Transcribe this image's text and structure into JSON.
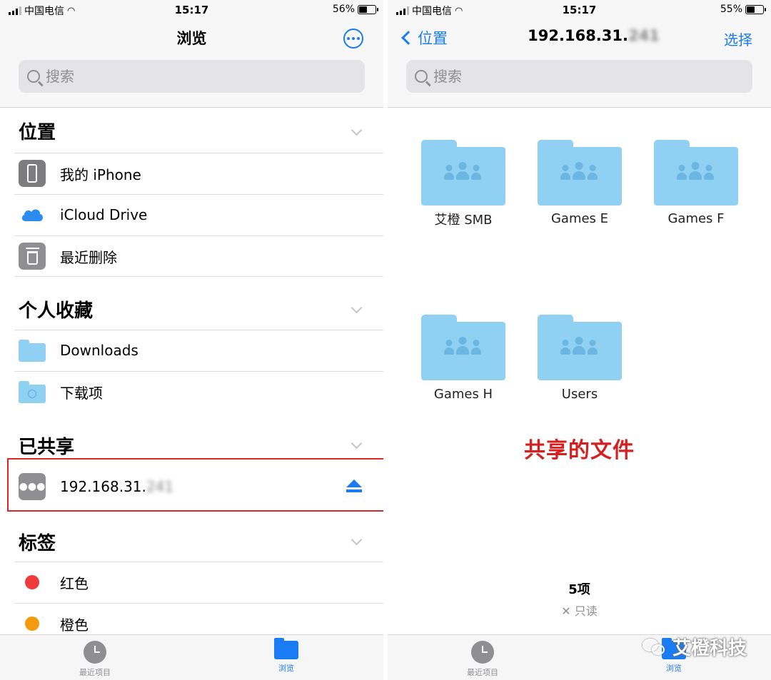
{
  "left": {
    "status": {
      "carrier": "中国电信",
      "time": "15:17",
      "battery": "56%",
      "battery_level": 0.56
    },
    "title": "浏览",
    "search_placeholder": "搜索",
    "sections": {
      "locations": {
        "header": "位置",
        "items": [
          "我的 iPhone",
          "iCloud Drive",
          "最近删除"
        ]
      },
      "favorites": {
        "header": "个人收藏",
        "items": [
          "Downloads",
          "下载项"
        ]
      },
      "shared": {
        "header": "已共享",
        "server_prefix": "192.168.31.",
        "server_suffix_blurred": "241"
      },
      "tags": {
        "header": "标签",
        "items": [
          {
            "label": "红色",
            "color": "#f03b3b"
          },
          {
            "label": "橙色",
            "color": "#f59a0c"
          }
        ]
      }
    },
    "tabs": {
      "recents": "最近项目",
      "browse": "浏览"
    }
  },
  "right": {
    "status": {
      "carrier": "中国电信",
      "time": "15:17",
      "battery": "55%",
      "battery_level": 0.55
    },
    "back_label": "位置",
    "title_prefix": "192.168.31.",
    "title_suffix_blurred": "241",
    "select_label": "选择",
    "search_placeholder": "搜索",
    "folders": [
      "艾橙 SMB",
      "Games E",
      "Games F",
      "Games H",
      "Users"
    ],
    "annotation": "共享的文件",
    "item_count": "5项",
    "readonly": "✕ 只读",
    "tabs": {
      "recents": "最近项目",
      "browse": "浏览"
    }
  },
  "watermark": "艾橙科技",
  "colors": {
    "accent": "#1a7cf5",
    "folder": "#8fd0f3",
    "highlight": "#d42a2a"
  }
}
